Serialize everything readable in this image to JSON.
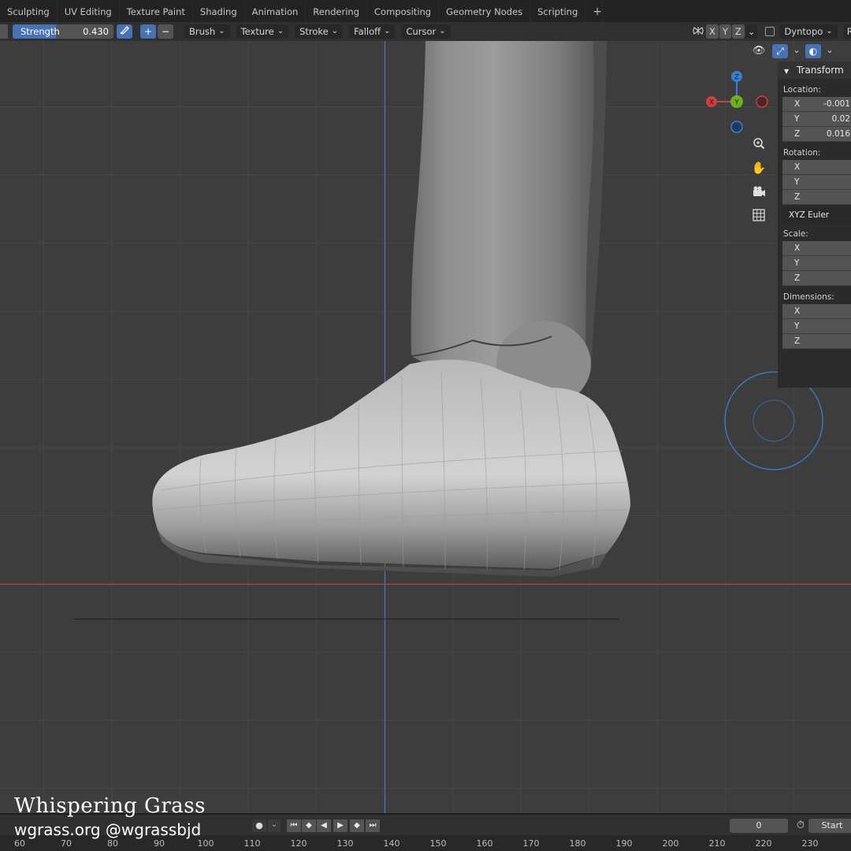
{
  "workspace_tabs": [
    "Sculpting",
    "UV Editing",
    "Texture Paint",
    "Shading",
    "Animation",
    "Rendering",
    "Compositing",
    "Geometry Nodes",
    "Scripting"
  ],
  "add_tab_label": "+",
  "toolbar": {
    "strength_label": "Strength",
    "strength_value": "0.430",
    "strength_fraction": 0.43,
    "add_label": "+",
    "subtract_label": "−",
    "brush": "Brush",
    "texture": "Texture",
    "stroke": "Stroke",
    "falloff": "Falloff",
    "cursor": "Cursor",
    "axis_x": "X",
    "axis_y": "Y",
    "axis_z": "Z",
    "dyntopo": "Dyntopo",
    "remesh_partial": "R"
  },
  "gizmo": {
    "x": "X",
    "y": "Y",
    "z": "Z"
  },
  "transform_panel": {
    "title": "Transform",
    "location_label": "Location:",
    "location": [
      {
        "axis": "X",
        "value": "-0.001"
      },
      {
        "axis": "Y",
        "value": "0.02"
      },
      {
        "axis": "Z",
        "value": "0.016"
      }
    ],
    "rotation_label": "Rotation:",
    "rotation": [
      {
        "axis": "X",
        "value": ""
      },
      {
        "axis": "Y",
        "value": ""
      },
      {
        "axis": "Z",
        "value": ""
      }
    ],
    "rotation_mode": "XYZ Euler",
    "scale_label": "Scale:",
    "scale": [
      {
        "axis": "X",
        "value": ""
      },
      {
        "axis": "Y",
        "value": ""
      },
      {
        "axis": "Z",
        "value": ""
      }
    ],
    "dimensions_label": "Dimensions:",
    "dimensions": [
      {
        "axis": "X",
        "value": ""
      },
      {
        "axis": "Y",
        "value": ""
      },
      {
        "axis": "Z",
        "value": ""
      }
    ]
  },
  "timeline": {
    "current_frame": "0",
    "start_label": "Start",
    "ruler_ticks": [
      "60",
      "70",
      "80",
      "90",
      "100",
      "110",
      "120",
      "130",
      "140",
      "150",
      "160",
      "170",
      "180",
      "190",
      "200",
      "210",
      "220",
      "230"
    ]
  },
  "watermark": {
    "line1": "Whispering Grass",
    "line2": "wgrass.org @wgrassbjd"
  },
  "colors": {
    "accent": "#4772b3",
    "axis_x": "#c84040",
    "axis_y": "#6fb020",
    "axis_z": "#3a7fcf"
  }
}
